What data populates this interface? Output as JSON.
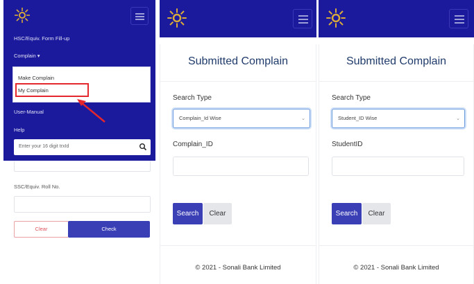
{
  "panel1": {
    "nav": {
      "form_fillup": "HSC/Equiv. Form Fill-up",
      "complain": "Complain ▾",
      "user_manual": "User-Manual",
      "help": "Help"
    },
    "dropdown": {
      "items": [
        "Make Complain",
        "My Complain"
      ],
      "highlighted_index": 1
    },
    "search": {
      "placeholder": "Enter your 16 digit trxId"
    },
    "roll_label": "SSC/Equiv. Roll No.",
    "clear_label": "Clear",
    "check_label": "Check"
  },
  "panel2": {
    "title": "Submitted Complain",
    "search_type_label": "Search Type",
    "search_type_value": "Complain_Id Wise",
    "id_label": "Complain_ID",
    "search_btn": "Search",
    "clear_btn": "Clear",
    "footer": "© 2021 - Sonali Bank Limited"
  },
  "panel3": {
    "title": "Submitted Complain",
    "search_type_label": "Search Type",
    "search_type_value": "Student_ID Wise",
    "id_label": "StudentID",
    "search_btn": "Search",
    "clear_btn": "Clear",
    "footer": "© 2021 - Sonali Bank Limited"
  },
  "colors": {
    "brand_blue": "#1c1a9c",
    "button_blue": "#3b3fb6",
    "highlight_red": "#e4262d",
    "logo_gold": "#d9a93a"
  },
  "icons": [
    "sonali-bank-logo-icon",
    "hamburger-menu-icon",
    "search-icon",
    "chevron-down-icon",
    "red-arrow-icon"
  ]
}
